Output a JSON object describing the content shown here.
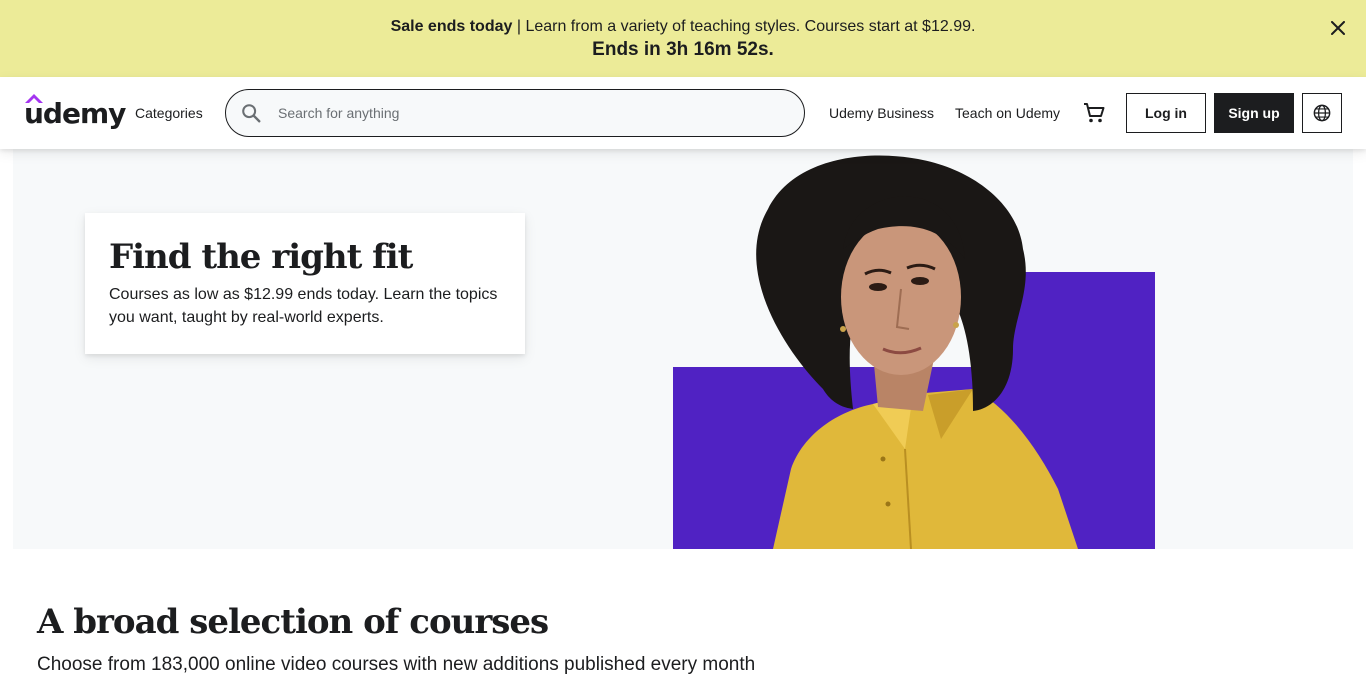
{
  "promo": {
    "bold": "Sale ends today",
    "text": " | Learn from a variety of teaching styles. Courses start at $12.99.",
    "countdown": "Ends in 3h 16m 52s.",
    "background": "#eceb98"
  },
  "header": {
    "logo": "udemy",
    "categories": "Categories",
    "search_placeholder": "Search for anything",
    "business": "Udemy Business",
    "teach": "Teach on Udemy",
    "login": "Log in",
    "signup": "Sign up",
    "icons": [
      "search-icon",
      "cart-icon",
      "globe-icon",
      "close-icon"
    ],
    "accent": "#a435f0"
  },
  "hero": {
    "title": "Find the right fit",
    "text": "Courses as low as $12.99 ends today. Learn the topics you want, taught by real-world experts.",
    "accent_block": "#5022c3",
    "shirt_color": "#e0b83a"
  },
  "section": {
    "title": "A broad selection of courses",
    "subtitle": "Choose from 183,000 online video courses with new additions published every month"
  }
}
